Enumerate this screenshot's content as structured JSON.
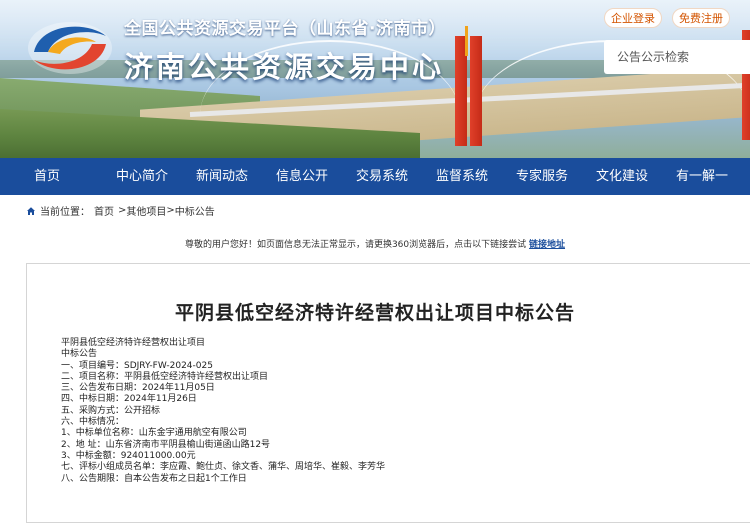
{
  "header": {
    "title_top": "全国公共资源交易平台（山东省·济南市）",
    "title_main": "济南公共资源交易中心",
    "login_label": "企业登录",
    "register_label": "免费注册",
    "search_placeholder": "公告公示检索",
    "accent_color": "#1a4d9c"
  },
  "nav": {
    "items": [
      {
        "label": "首页"
      },
      {
        "label": "中心简介"
      },
      {
        "label": "新闻动态"
      },
      {
        "label": "信息公开"
      },
      {
        "label": "交易系统"
      },
      {
        "label": "监督系统"
      },
      {
        "label": "专家服务"
      },
      {
        "label": "文化建设"
      },
      {
        "label": "有一解一"
      }
    ]
  },
  "breadcrumb": {
    "prefix": "当前位置：",
    "home": "首页",
    "sep1": ">",
    "level1": "其他项目",
    "sep2": ">",
    "level2": "中标公告",
    "icon": "home-icon"
  },
  "notice": {
    "text": "尊敬的用户您好！如页面信息无法正常显示，请更换360浏览器后，点击以下链接尝试",
    "link": "链接地址"
  },
  "document": {
    "title": "平阴县低空经济特许经营权出让项目中标公告",
    "lines": [
      "平阴县低空经济特许经营权出让项目",
      "中标公告",
      "一、项目编号：SDJRY-FW-2024-025",
      "二、项目名称：平阴县低空经济特许经营权出让项目",
      "三、公告发布日期：2024年11月05日",
      "四、中标日期：2024年11月26日",
      "五、采购方式：公开招标",
      "六、中标情况：",
      "1、中标单位名称：山东金宇通用航空有限公司",
      "2、地 址：山东省济南市平阴县榆山街道函山路12号",
      "3、中标金额：924011000.00元",
      "七、评标小组成员名单：李应霞、鲍仕贞、徐文香、蒲华、周培华、崔毅、李芳华",
      "八、公告期限：自本公告发布之日起1个工作日"
    ]
  }
}
